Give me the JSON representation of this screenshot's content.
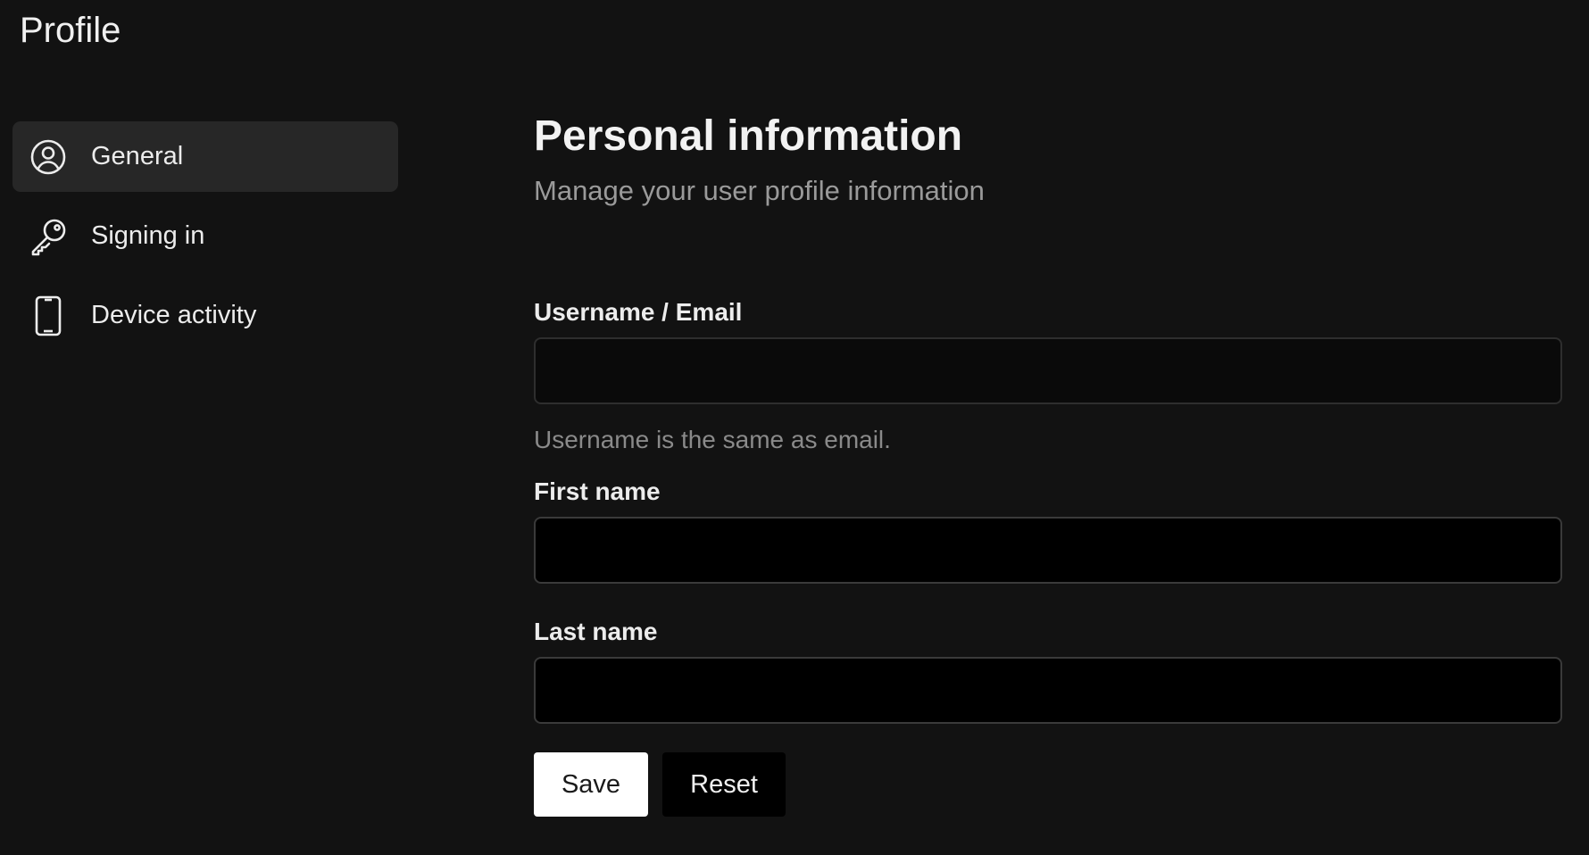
{
  "header": {
    "title": "Profile"
  },
  "sidebar": {
    "items": [
      {
        "label": "General",
        "icon": "user-circle-icon",
        "active": true
      },
      {
        "label": "Signing in",
        "icon": "key-icon",
        "active": false
      },
      {
        "label": "Device activity",
        "icon": "smartphone-icon",
        "active": false
      }
    ]
  },
  "main": {
    "title": "Personal information",
    "subtitle": "Manage your user profile information",
    "fields": {
      "username": {
        "label": "Username / Email",
        "value": "",
        "helper": "Username is the same as email."
      },
      "first_name": {
        "label": "First name",
        "value": ""
      },
      "last_name": {
        "label": "Last name",
        "value": ""
      }
    },
    "actions": {
      "save_label": "Save",
      "reset_label": "Reset"
    }
  }
}
